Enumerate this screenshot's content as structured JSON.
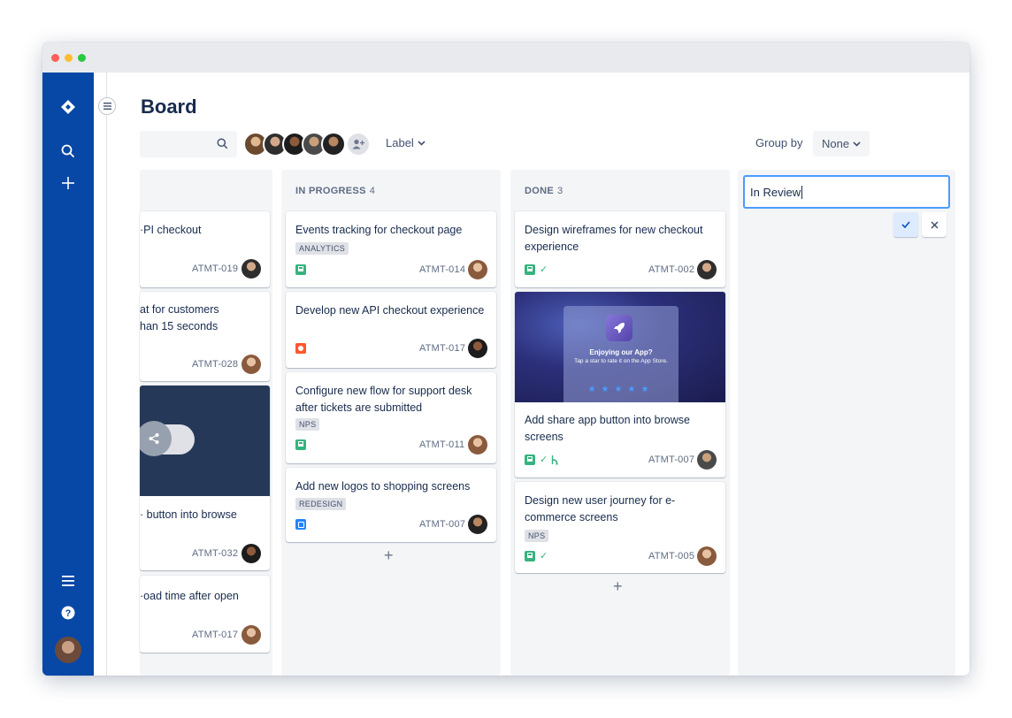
{
  "page": {
    "title": "Board"
  },
  "toolbar": {
    "filter_label": "Label",
    "group_by_label": "Group by",
    "group_by_value": "None"
  },
  "colors": {
    "nav_bg": "#0747a6",
    "accent": "#4c9aff",
    "column_bg": "#f4f5f7"
  },
  "columns": [
    {
      "title": "",
      "cards": [
        {
          "title": "·PI checkout",
          "key": "ATMT-019"
        },
        {
          "title": "at for customers\nhan 15 seconds",
          "key": "ATMT-028"
        },
        {
          "title": "· button into browse",
          "key": "ATMT-032"
        },
        {
          "title": "·oad time after open",
          "key": "ATMT-017"
        }
      ]
    },
    {
      "title": "IN PROGRESS",
      "count": "4",
      "cards": [
        {
          "title": "Events tracking for checkout page",
          "label": "ANALYTICS",
          "key": "ATMT-014",
          "type": "story"
        },
        {
          "title": "Develop new API checkout experience",
          "key": "ATMT-017",
          "type": "bug"
        },
        {
          "title": "Configure new flow for support desk after tickets are submitted",
          "label": "NPS",
          "key": "ATMT-011",
          "type": "story"
        },
        {
          "title": "Add new logos to shopping screens",
          "label": "REDESIGN",
          "key": "ATMT-007",
          "type": "task"
        }
      ]
    },
    {
      "title": "DONE",
      "count": "3",
      "cards": [
        {
          "title": "Design wireframes for new checkout experience",
          "key": "ATMT-002",
          "type": "story"
        },
        {
          "title": "Add share app button into browse screens",
          "key": "ATMT-007",
          "type": "story",
          "image": {
            "title": "Enjoying our App?",
            "subtitle": "Tap a star to rate it on the App Store.",
            "stars": "★★★★★"
          }
        },
        {
          "title": "Design new user journey for e-commerce screens",
          "label": "NPS",
          "key": "ATMT-005",
          "type": "story"
        }
      ]
    }
  ],
  "new_column": {
    "value": "In Review"
  }
}
